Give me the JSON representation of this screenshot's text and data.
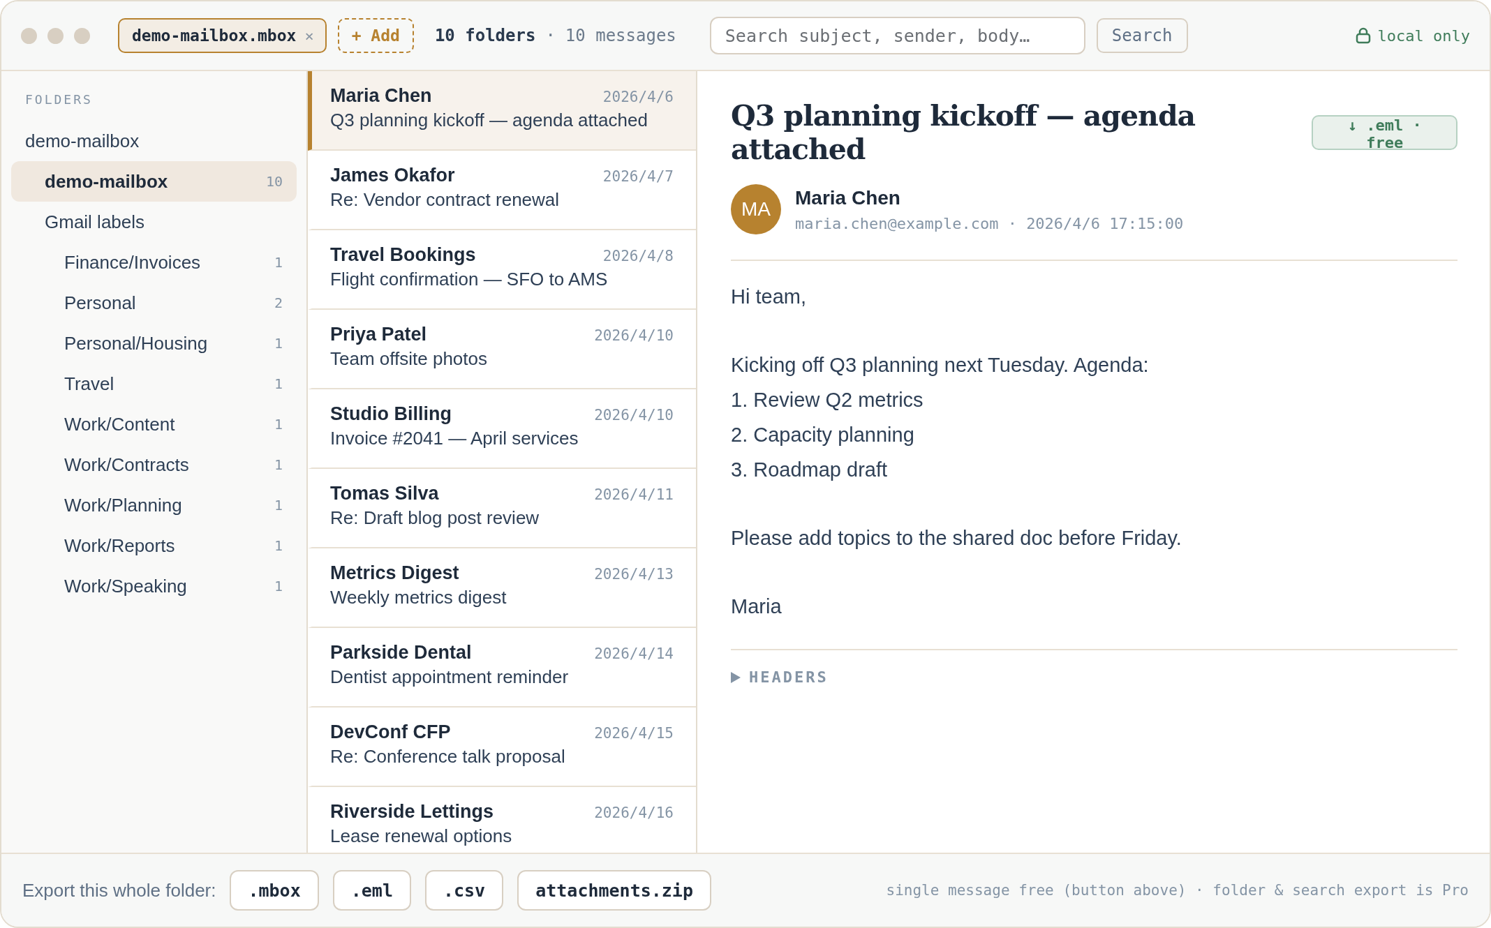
{
  "window_controls": [
    {
      "kind": "dot"
    },
    {
      "kind": "dot"
    },
    {
      "kind": "dot"
    }
  ],
  "file_tabs": [
    {
      "label": "demo-mailbox.mbox",
      "close": "×",
      "selected": true
    }
  ],
  "add_button": "+ Add",
  "summary": {
    "folders": "10 folders",
    "separator": "·",
    "messages": "10 messages"
  },
  "search": {
    "placeholder": "Search subject, sender, body…",
    "button": "Search"
  },
  "privacy": "local only",
  "sidebar": {
    "heading": "FOLDERS",
    "tree": [
      {
        "label": "demo-mailbox",
        "selected": false,
        "children": [
          {
            "label": "demo-mailbox",
            "count": "10",
            "selected": true
          },
          {
            "label": "Gmail labels",
            "selected": false,
            "children": [
              {
                "label": "Finance/Invoices",
                "count": "1",
                "selected": false
              },
              {
                "label": "Personal",
                "count": "2",
                "selected": false
              },
              {
                "label": "Personal/Housing",
                "count": "1",
                "selected": false
              },
              {
                "label": "Travel",
                "count": "1",
                "selected": false
              },
              {
                "label": "Work/Content",
                "count": "1",
                "selected": false
              },
              {
                "label": "Work/Contracts",
                "count": "1",
                "selected": false
              },
              {
                "label": "Work/Planning",
                "count": "1",
                "selected": false
              },
              {
                "label": "Work/Reports",
                "count": "1",
                "selected": false
              },
              {
                "label": "Work/Speaking",
                "count": "1",
                "selected": false
              }
            ]
          }
        ]
      }
    ]
  },
  "messages": [
    {
      "sender": "Maria Chen",
      "date": "2026/4/6",
      "subject": "Q3 planning kickoff — agenda attached",
      "selected": true
    },
    {
      "sender": "James Okafor",
      "date": "2026/4/7",
      "subject": "Re: Vendor contract renewal",
      "selected": false
    },
    {
      "sender": "Travel Bookings",
      "date": "2026/4/8",
      "subject": "Flight confirmation — SFO to AMS",
      "selected": false
    },
    {
      "sender": "Priya Patel",
      "date": "2026/4/10",
      "subject": "Team offsite photos",
      "selected": false
    },
    {
      "sender": "Studio Billing",
      "date": "2026/4/10",
      "subject": "Invoice #2041 — April services",
      "selected": false
    },
    {
      "sender": "Tomas Silva",
      "date": "2026/4/11",
      "subject": "Re: Draft blog post review",
      "selected": false
    },
    {
      "sender": "Metrics Digest",
      "date": "2026/4/13",
      "subject": "Weekly metrics digest",
      "selected": false
    },
    {
      "sender": "Parkside Dental",
      "date": "2026/4/14",
      "subject": "Dentist appointment reminder",
      "selected": false
    },
    {
      "sender": "DevConf CFP",
      "date": "2026/4/15",
      "subject": "Re: Conference talk proposal",
      "selected": false
    },
    {
      "sender": "Riverside Lettings",
      "date": "2026/4/16",
      "subject": "Lease renewal options",
      "selected": false
    }
  ],
  "detail": {
    "title": "Q3 planning kickoff — agenda attached",
    "download": "↓ .eml · free",
    "avatar": "MA",
    "from_name": "Maria Chen",
    "from_meta": "maria.chen@example.com · 2026/4/6 17:15:00",
    "body": [
      [
        "Hi team,"
      ],
      [
        "Kicking off Q3 planning next Tuesday. Agenda:",
        "1. Review Q2 metrics",
        "2. Capacity planning",
        "3. Roadmap draft"
      ],
      [
        "Please add topics to the shared doc before Friday."
      ],
      [
        "Maria"
      ]
    ],
    "headers": {
      "label": "HEADERS",
      "expanded": false
    }
  },
  "footer": {
    "label": "Export this whole folder:",
    "buttons": [
      ".mbox",
      ".eml",
      ".csv",
      "attachments.zip"
    ],
    "note": "single message free (button above) · folder & search export is Pro"
  }
}
